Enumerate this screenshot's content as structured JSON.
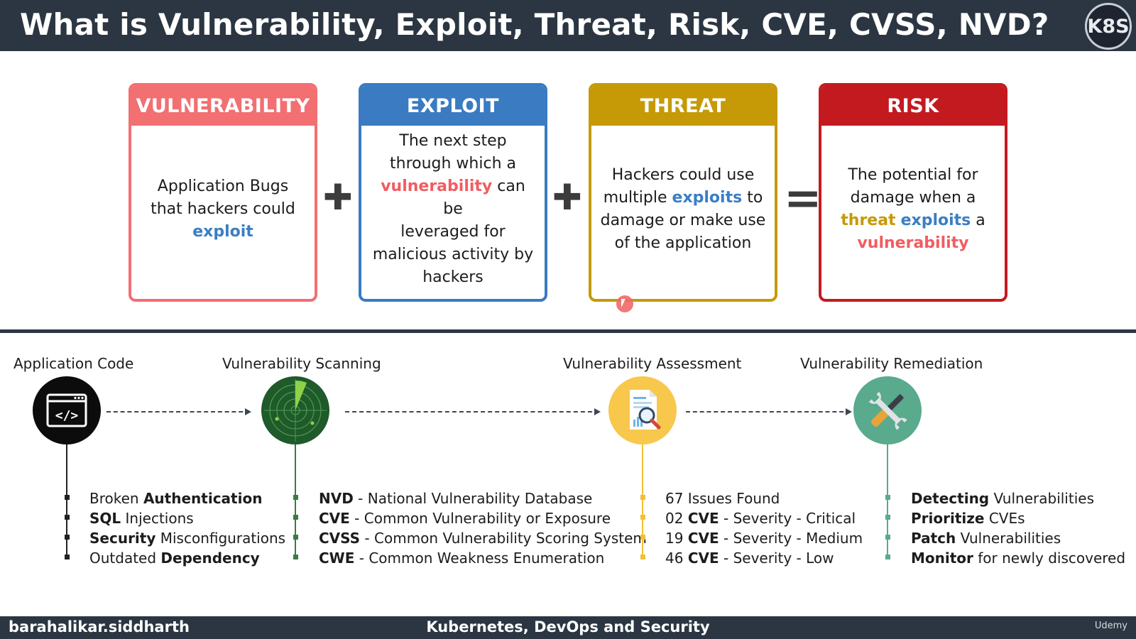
{
  "header": {
    "title": "What is Vulnerability, Exploit, Threat, Risk, CVE, CVSS, NVD?",
    "logo": "K8S"
  },
  "colors": {
    "vulnerability": "#f05d62",
    "exploit": "#3b7ec4",
    "threat": "#c59a06",
    "risk": "#c31a20",
    "bar": "#2b3642"
  },
  "cards": {
    "vulnerability": {
      "title": "VULNERABILITY",
      "l1": "Application Bugs",
      "l2": "that hackers could",
      "exploit": "exploit"
    },
    "exploit": {
      "title": "EXPLOIT",
      "l1": "The next step",
      "l2": "through which a",
      "vulnerability": "vulnerability",
      "can_be": " can be",
      "l4": "leveraged for",
      "l5": "malicious activity by",
      "l6": "hackers"
    },
    "threat": {
      "title": "THREAT",
      "l1": "Hackers could use",
      "multiple": "multiple ",
      "exploits": "exploits",
      "to": " to",
      "l3": "damage or make use",
      "l4": "of the application"
    },
    "risk": {
      "title": "RISK",
      "l1": "The potential for",
      "l2": "damage when a",
      "threat": "threat",
      "exploits": "exploits",
      "a": " a",
      "vulnerability": "vulnerability"
    }
  },
  "operators": {
    "plus1": "✚",
    "plus2": "✚",
    "equals": "="
  },
  "pipeline": {
    "code": {
      "label": "Application Code",
      "icon": "code-window-icon",
      "items": [
        {
          "pre": "Broken ",
          "bold": "Authentication",
          "post": ""
        },
        {
          "pre": "",
          "bold": "SQL",
          "post": " Injections"
        },
        {
          "pre": "",
          "bold": "Security",
          "post": " Misconfigurations"
        },
        {
          "pre": "Outdated ",
          "bold": "Dependency",
          "post": ""
        }
      ]
    },
    "scanning": {
      "label": "Vulnerability Scanning",
      "icon": "radar-icon",
      "items": [
        {
          "bold": "NVD",
          "post": " - National Vulnerability Database"
        },
        {
          "bold": "CVE",
          "post": " - Common Vulnerability or Exposure"
        },
        {
          "bold": "CVSS",
          "post": " - Common Vulnerability Scoring System"
        },
        {
          "bold": "CWE",
          "post": " - Common Weakness Enumeration"
        }
      ]
    },
    "assessment": {
      "label": "Vulnerability Assessment",
      "icon": "report-magnifier-icon",
      "items": [
        {
          "pre": "67 Issues Found",
          "bold": "",
          "post": ""
        },
        {
          "pre": "02 ",
          "bold": "CVE",
          "post": " - Severity - Critical"
        },
        {
          "pre": "19 ",
          "bold": "CVE",
          "post": " - Severity - Medium"
        },
        {
          "pre": "46 ",
          "bold": "CVE",
          "post": " - Severity - Low"
        }
      ]
    },
    "remediation": {
      "label": "Vulnerability Remediation",
      "icon": "wrench-screwdriver-icon",
      "items": [
        {
          "bold": "Detecting",
          "post": " Vulnerabilities"
        },
        {
          "bold": "Prioritize",
          "post": " CVEs"
        },
        {
          "bold": "Patch",
          "post": " Vulnerabilities"
        },
        {
          "bold": "Monitor",
          "post": " for newly discovered"
        }
      ]
    }
  },
  "footer": {
    "left": "barahalikar.siddharth",
    "center": "Kubernetes, DevOps and Security",
    "right": "Udemy"
  }
}
